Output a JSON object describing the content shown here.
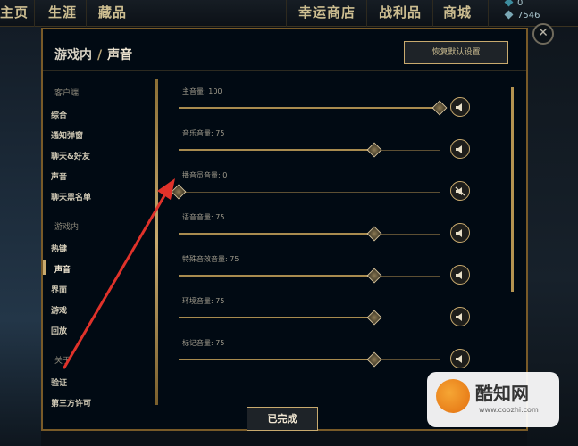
{
  "topbar": {
    "nav_home": "主页",
    "nav_career": "生涯",
    "nav_collection": "藏品",
    "nav_lucky_shop": "幸运商店",
    "nav_loot": "战利品",
    "nav_store": "商城",
    "rp_amount": "0",
    "be_amount": "7546"
  },
  "modal": {
    "breadcrumb_parent": "游戏内",
    "breadcrumb_sep": "/",
    "breadcrumb_current": "声音",
    "restore_defaults_label": "恢复默认设置",
    "done_label": "已完成"
  },
  "sidebar": {
    "section_client": "客户端",
    "client_items": [
      "综合",
      "通知弹窗",
      "聊天&好友",
      "声音",
      "聊天黑名单"
    ],
    "section_ingame": "游戏内",
    "ingame_items": [
      "热键",
      "声音",
      "界面",
      "游戏",
      "回放"
    ],
    "section_about": "关于",
    "about_items": [
      "验证",
      "第三方许可"
    ],
    "active_item": "声音"
  },
  "sliders": [
    {
      "label": "主音量: 100",
      "value": 100,
      "muted": false
    },
    {
      "label": "音乐音量: 75",
      "value": 75,
      "muted": false
    },
    {
      "label": "播音员音量: 0",
      "value": 0,
      "muted": true
    },
    {
      "label": "语音音量: 75",
      "value": 75,
      "muted": false
    },
    {
      "label": "特殊音效音量: 75",
      "value": 75,
      "muted": false
    },
    {
      "label": "环境音量: 75",
      "value": 75,
      "muted": false
    },
    {
      "label": "标记音量: 75",
      "value": 75,
      "muted": false
    }
  ],
  "watermark": {
    "brand": "酷知网",
    "url": "www.coozhi.com"
  },
  "colors": {
    "gold": "#c8aa6e",
    "annotation_arrow": "#e0322a",
    "background": "#010a13"
  }
}
